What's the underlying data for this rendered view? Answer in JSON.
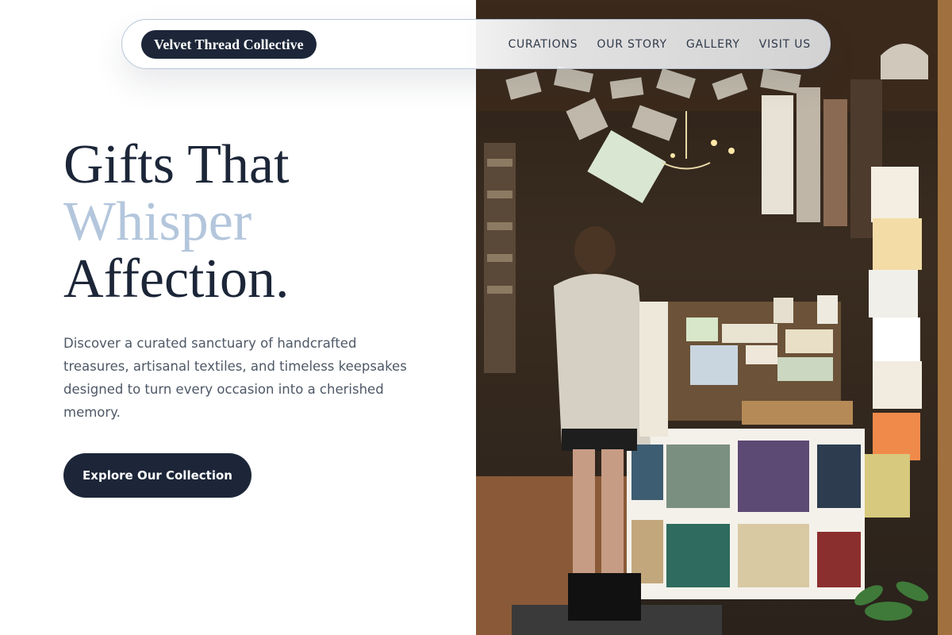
{
  "nav": {
    "brand": "Velvet Thread Collective",
    "links": [
      {
        "label": "CURATIONS"
      },
      {
        "label": "OUR STORY"
      },
      {
        "label": "GALLERY"
      },
      {
        "label": "VISIT US"
      }
    ]
  },
  "hero": {
    "title_line1": "Gifts That",
    "title_line2": "Whisper",
    "title_line3": "Affection.",
    "description": "Discover a curated sanctuary of handcrafted treasures, artisanal textiles, and timeless keepsakes designed to turn every occasion into a cherished memory.",
    "cta_label": "Explore Our Collection"
  },
  "colors": {
    "primary": "#1c2638",
    "accent": "#b3c6dc",
    "body_text": "#4e5866",
    "nav_border": "#b7c6da"
  }
}
